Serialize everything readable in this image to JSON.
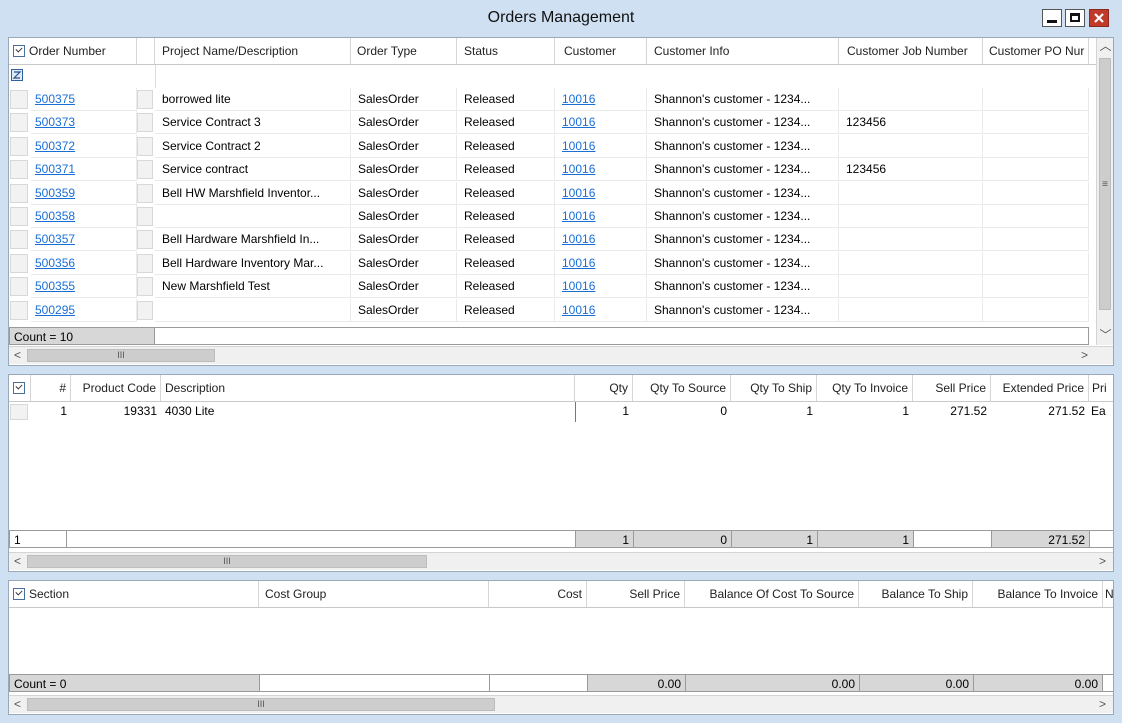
{
  "window": {
    "title": "Orders Management"
  },
  "orders": {
    "columns": [
      "Order Number",
      "Project Name/Description",
      "Order Type",
      "Status",
      "Customer",
      "Customer Info",
      "Customer Job Number",
      "Customer PO Nur"
    ],
    "rows": [
      {
        "order": "500375",
        "project": "borrowed lite",
        "type": "SalesOrder",
        "status": "Released",
        "customer": "10016",
        "info": "Shannon's customer - 1234...",
        "job": ""
      },
      {
        "order": "500373",
        "project": "Service Contract 3",
        "type": "SalesOrder",
        "status": "Released",
        "customer": "10016",
        "info": "Shannon's customer - 1234...",
        "job": "123456"
      },
      {
        "order": "500372",
        "project": "Service Contract 2",
        "type": "SalesOrder",
        "status": "Released",
        "customer": "10016",
        "info": "Shannon's customer - 1234...",
        "job": ""
      },
      {
        "order": "500371",
        "project": "Service contract",
        "type": "SalesOrder",
        "status": "Released",
        "customer": "10016",
        "info": "Shannon's customer - 1234...",
        "job": "123456"
      },
      {
        "order": "500359",
        "project": "Bell HW Marshfield Inventor...",
        "type": "SalesOrder",
        "status": "Released",
        "customer": "10016",
        "info": "Shannon's customer - 1234...",
        "job": ""
      },
      {
        "order": "500358",
        "project": "",
        "type": "SalesOrder",
        "status": "Released",
        "customer": "10016",
        "info": "Shannon's customer - 1234...",
        "job": ""
      },
      {
        "order": "500357",
        "project": "Bell Hardware Marshfield In...",
        "type": "SalesOrder",
        "status": "Released",
        "customer": "10016",
        "info": "Shannon's customer - 1234...",
        "job": ""
      },
      {
        "order": "500356",
        "project": "Bell Hardware Inventory Mar...",
        "type": "SalesOrder",
        "status": "Released",
        "customer": "10016",
        "info": "Shannon's customer - 1234...",
        "job": ""
      },
      {
        "order": "500355",
        "project": "New Marshfield Test",
        "type": "SalesOrder",
        "status": "Released",
        "customer": "10016",
        "info": "Shannon's customer - 1234...",
        "job": ""
      },
      {
        "order": "500295",
        "project": "",
        "type": "SalesOrder",
        "status": "Released",
        "customer": "10016",
        "info": "Shannon's customer - 1234...",
        "job": ""
      }
    ],
    "count_label": "Count = 10"
  },
  "lines": {
    "columns": [
      "#",
      "Product Code",
      "Description",
      "Qty",
      "Qty To Source",
      "Qty To Ship",
      "Qty To Invoice",
      "Sell Price",
      "Extended Price",
      "Pri"
    ],
    "rows": [
      {
        "num": "1",
        "code": "19331",
        "desc": "4030 Lite",
        "qty": "1",
        "source": "0",
        "ship": "1",
        "invoice": "1",
        "sell": "271.52",
        "ext": "271.52",
        "pri": "Ea"
      }
    ],
    "footer": {
      "num": "1",
      "qty": "1",
      "source": "0",
      "ship": "1",
      "invoice": "1",
      "ext": "271.52"
    }
  },
  "sections": {
    "columns": [
      "Section",
      "Cost Group",
      "Cost",
      "Sell Price",
      "Balance Of Cost To Source",
      "Balance To Ship",
      "Balance To Invoice",
      "N"
    ],
    "count_label": "Count = 0",
    "footer": {
      "sell": "0.00",
      "source": "0.00",
      "ship": "0.00",
      "invoice": "0.00"
    }
  },
  "icons": {
    "min": "minimize-icon",
    "max": "maximize-icon",
    "close": "close-icon",
    "filter": "filter-icon",
    "scroll_thumb": "grip-icon"
  }
}
